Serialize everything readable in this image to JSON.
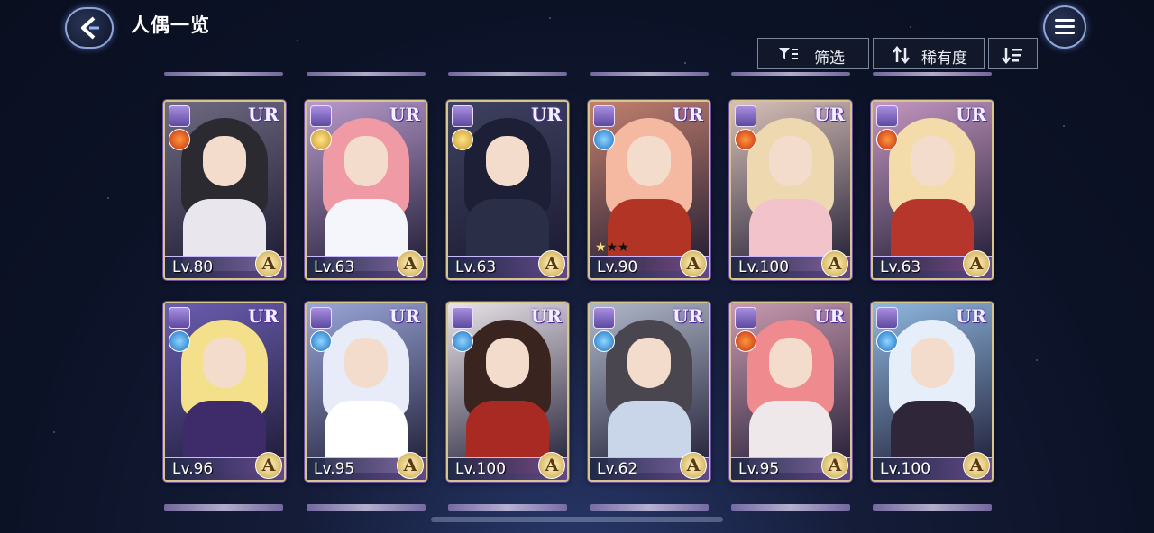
{
  "header": {
    "title": "人偶一览"
  },
  "toolbar": {
    "filter_label": "筛选",
    "sort_label": "稀有度"
  },
  "cards": [
    {
      "rarity": "UR",
      "level": "Lv.80",
      "grade": "A",
      "element": "fire",
      "hair": "#2a2a30",
      "outfit": "#e9e6ee",
      "bg": "#6e6a80"
    },
    {
      "rarity": "UR",
      "level": "Lv.63",
      "grade": "A",
      "element": "light",
      "hair": "#f09aa6",
      "outfit": "#f4f6fb",
      "bg": "#b89acb"
    },
    {
      "rarity": "UR",
      "level": "Lv.63",
      "grade": "A",
      "element": "light",
      "hair": "#1c1f35",
      "outfit": "#2a2e46",
      "bg": "#3e4260"
    },
    {
      "rarity": "UR",
      "level": "Lv.90",
      "grade": "A",
      "element": "water",
      "hair": "#f5b9a2",
      "outfit": "#b23424",
      "bg": "#c2806e",
      "stars": [
        "on",
        "off",
        "off"
      ]
    },
    {
      "rarity": "UR",
      "level": "Lv.100",
      "grade": "A",
      "element": "fire",
      "hair": "#eed8b0",
      "outfit": "#f3c3cc",
      "bg": "#d8c0b8"
    },
    {
      "rarity": "UR",
      "level": "Lv.63",
      "grade": "A",
      "element": "fire",
      "hair": "#f3dcaa",
      "outfit": "#b7362c",
      "bg": "#c497c0"
    },
    {
      "rarity": "UR",
      "level": "Lv.96",
      "grade": "A",
      "element": "water",
      "hair": "#f4e08a",
      "outfit": "#3e2c6a",
      "bg": "#6a5db0"
    },
    {
      "rarity": "UR",
      "level": "Lv.95",
      "grade": "A",
      "element": "water",
      "hair": "#e8ecf8",
      "outfit": "#ffffff",
      "bg": "#9aa6d8"
    },
    {
      "rarity": "UR",
      "level": "Lv.100",
      "grade": "A",
      "element": "water",
      "hair": "#3a2420",
      "outfit": "#a82a22",
      "bg": "#e9e3e8"
    },
    {
      "rarity": "UR",
      "level": "Lv.62",
      "grade": "A",
      "element": "water",
      "hair": "#4a4650",
      "outfit": "#c9d6ea",
      "bg": "#b0b8c8"
    },
    {
      "rarity": "UR",
      "level": "Lv.95",
      "grade": "A",
      "element": "fire",
      "hair": "#ef8a8e",
      "outfit": "#efe8ea",
      "bg": "#c99ab0"
    },
    {
      "rarity": "UR",
      "level": "Lv.100",
      "grade": "A",
      "element": "water",
      "hair": "#e6eefa",
      "outfit": "#30263a",
      "bg": "#8fb7df"
    }
  ]
}
